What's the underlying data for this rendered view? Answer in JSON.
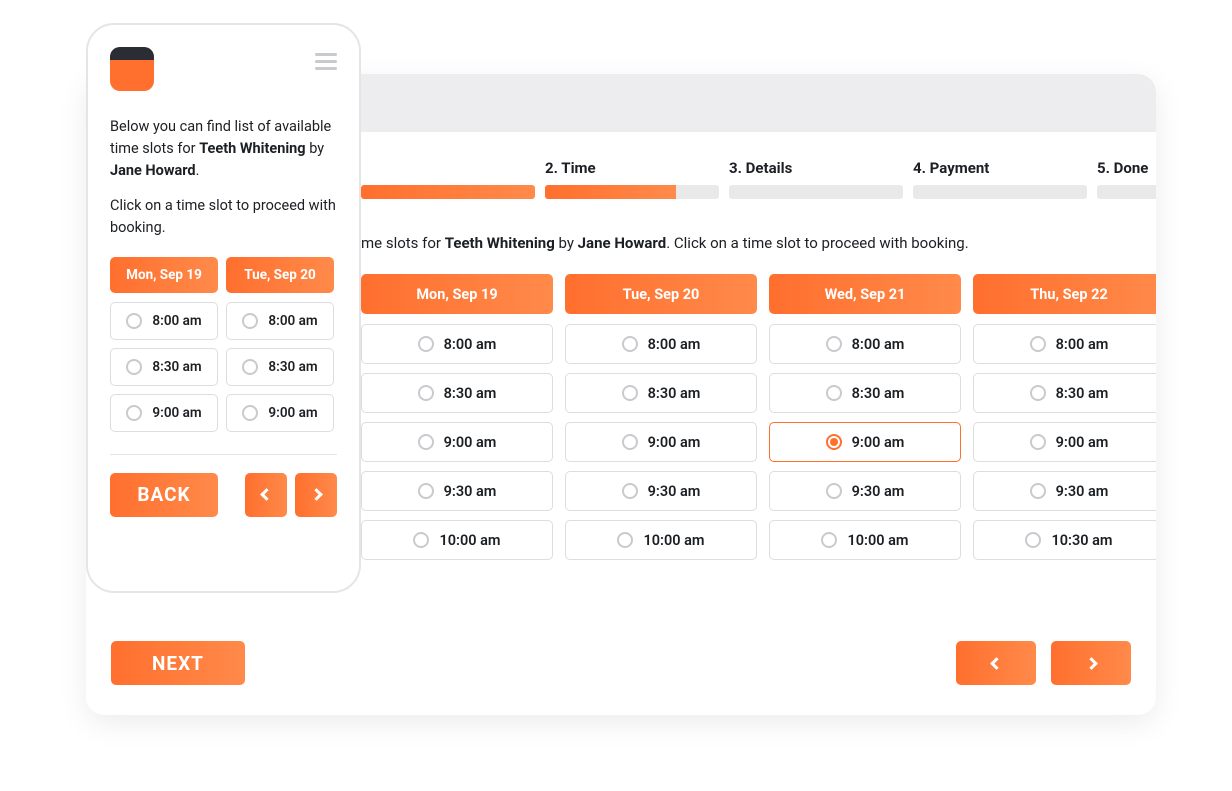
{
  "labels": {
    "next": "NEXT",
    "back": "BACK"
  },
  "service_name": "Teeth Whitening",
  "provider_name": "Jane Howard",
  "intro_prefix_short": "me slots for ",
  "intro_by": " by ",
  "intro_suffix": ". Click on a time slot to proceed with booking.",
  "mobile": {
    "p1_prefix": "Below you can find list of available time slots for ",
    "p1_by": " by ",
    "p1_suffix": ".",
    "p2": "Click on a time slot to proceed with booking."
  },
  "steps": [
    {
      "label": "2. Time",
      "state": "partial"
    },
    {
      "label": "3. Details",
      "state": "empty"
    },
    {
      "label": "4. Payment",
      "state": "empty"
    },
    {
      "label": "5. Done",
      "state": "empty"
    }
  ],
  "desktop_columns": [
    {
      "day": "Mon, Sep 19",
      "slots": [
        "8:00 am",
        "8:30 am",
        "9:00 am",
        "9:30 am",
        "10:00 am"
      ],
      "selected": null
    },
    {
      "day": "Tue, Sep 20",
      "slots": [
        "8:00 am",
        "8:30 am",
        "9:00 am",
        "9:30 am",
        "10:00 am"
      ],
      "selected": null
    },
    {
      "day": "Wed, Sep 21",
      "slots": [
        "8:00 am",
        "8:30 am",
        "9:00 am",
        "9:30 am",
        "10:00 am"
      ],
      "selected": "9:00 am"
    },
    {
      "day": "Thu, Sep 22",
      "slots": [
        "8:00 am",
        "8:30 am",
        "9:00 am",
        "9:30 am",
        "10:30 am"
      ],
      "selected": null
    }
  ],
  "mobile_columns": [
    {
      "day": "Mon, Sep 19",
      "slots": [
        "8:00 am",
        "8:30 am",
        "9:00 am"
      ]
    },
    {
      "day": "Tue, Sep 20",
      "slots": [
        "8:00 am",
        "8:30 am",
        "9:00 am"
      ]
    }
  ]
}
